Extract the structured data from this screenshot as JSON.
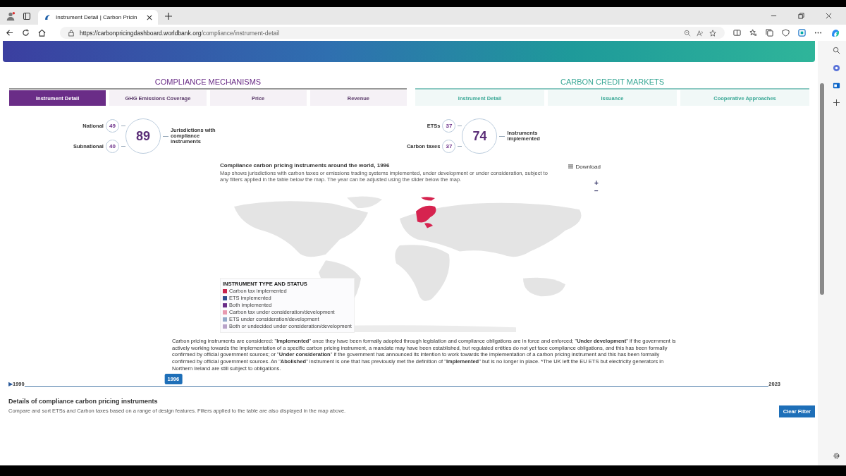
{
  "browser": {
    "tab_title": "Instrument Detail | Carbon Pricin",
    "url_host": "https://carbonpricingdashboard.worldbank.org",
    "url_path": "/compliance/instrument-detail"
  },
  "sections": [
    {
      "title": "COMPLIANCE MECHANISMS",
      "kind": "compliance",
      "tabs": [
        {
          "label": "Instrument Detail",
          "selected": true
        },
        {
          "label": "GHG Emissions Coverage",
          "selected": false
        },
        {
          "label": "Price",
          "selected": false
        },
        {
          "label": "Revenue",
          "selected": false
        }
      ]
    },
    {
      "title": "CARBON CREDIT MARKETS",
      "kind": "credit",
      "tabs": [
        {
          "label": "Instrument Detail",
          "selected": false
        },
        {
          "label": "Issuance",
          "selected": false
        },
        {
          "label": "Cooperative Approaches",
          "selected": false
        }
      ]
    }
  ],
  "stats": [
    {
      "parts": [
        {
          "label": "National",
          "value": "49"
        },
        {
          "label": "Subnational",
          "value": "40"
        }
      ],
      "total": "89",
      "caption": "Jurisdictions with compliance instruments"
    },
    {
      "parts": [
        {
          "label": "ETSs",
          "value": "37"
        },
        {
          "label": "Carbon taxes",
          "value": "37"
        }
      ],
      "total": "74",
      "caption": "Instruments implemented"
    }
  ],
  "map": {
    "title": "Compliance carbon pricing instruments around the world, 1996",
    "description": "Map shows jurisdictions with carbon taxes or emissions trading systems implemented, under development or under consideration, subject to any filters applied in the table below the map. The year can be adjusted using the slider below the map.",
    "download": "Download",
    "zoom_in": "+",
    "zoom_out": "−",
    "legend_title": "INSTRUMENT TYPE AND STATUS",
    "legend": [
      {
        "label": "Carbon tax implemented",
        "color": "#c8244c"
      },
      {
        "label": "ETS implemented",
        "color": "#2f4f8f"
      },
      {
        "label": "Both implemented",
        "color": "#6a2d87"
      },
      {
        "label": "Carbon tax under consideration/development",
        "color": "#e89ab0"
      },
      {
        "label": "ETS under consideration/development",
        "color": "#93a9c9"
      },
      {
        "label": "Both or undecided under consideration/development",
        "color": "#b9a3c9"
      }
    ]
  },
  "note": "Carbon pricing instruments are considered: \"**Implemented**\" once they have been formally adopted through legislation and compliance obligations are in force and enforced; \"**Under development**\" if the government is actively working towards the implementation of a specific carbon pricing instrument, a mandate may have been established, but regulated entities do not yet face compliance obligations, and this has been formally confirmed by official government sources; or \"**Under consideration**\" if the government has announced its intention to work towards the implementation of a carbon pricing instrument and this has been formally confirmed by official government sources. An \"**Abolished**\" instrument is one that has previously met the definition of \"**Implemented**\" but is no longer in place. *The UK left the EU ETS but electricity generators in Northern Ireland are still subject to obligations.",
  "year_slider": {
    "play": "▶",
    "start": "1990",
    "end": "2023",
    "value": "1996",
    "level": 0.2
  },
  "details": {
    "title": "Details of compliance carbon pricing instruments",
    "description": "Compare and sort ETSs and Carbon taxes based on a range of design features. Filters applied to the table are also displayed in the map above.",
    "clear_filter": "Clear Filter"
  }
}
